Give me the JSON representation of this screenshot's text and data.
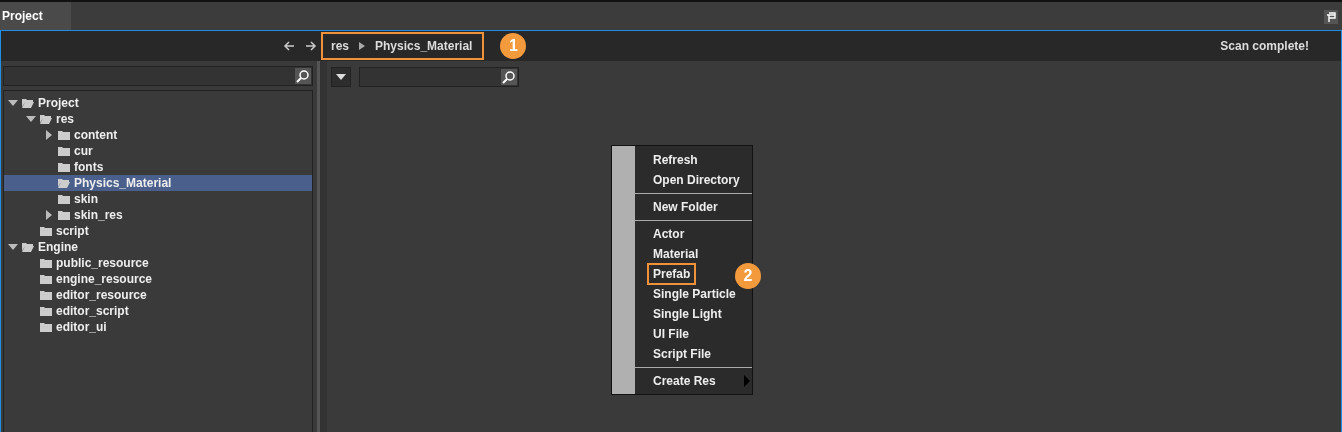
{
  "tab": {
    "label": "Project",
    "selected": true
  },
  "breadcrumb": {
    "items": [
      "res",
      "Physics_Material"
    ],
    "callout": "1"
  },
  "status": "Scan complete!",
  "tree": [
    {
      "label": "Project",
      "expanded": true,
      "selected": false,
      "children": [
        {
          "label": "res",
          "expanded": true,
          "selected": false,
          "children": [
            {
              "label": "content",
              "expanded": false,
              "selected": false
            },
            {
              "label": "cur",
              "selected": false
            },
            {
              "label": "fonts",
              "selected": false
            },
            {
              "label": "Physics_Material",
              "selected": true
            },
            {
              "label": "skin",
              "selected": false
            },
            {
              "label": "skin_res",
              "expanded": false,
              "selected": false
            }
          ]
        },
        {
          "label": "script",
          "selected": false
        }
      ]
    },
    {
      "label": "Engine",
      "expanded": true,
      "selected": false,
      "children": [
        {
          "label": "public_resource",
          "selected": false
        },
        {
          "label": "engine_resource",
          "selected": false
        },
        {
          "label": "editor_resource",
          "selected": false
        },
        {
          "label": "editor_script",
          "selected": false
        },
        {
          "label": "editor_ui",
          "selected": false
        }
      ]
    }
  ],
  "menu": [
    {
      "kind": "item",
      "label": "Refresh"
    },
    {
      "kind": "item",
      "label": "Open Directory"
    },
    {
      "kind": "separator"
    },
    {
      "kind": "item",
      "label": "New Folder"
    },
    {
      "kind": "separator"
    },
    {
      "kind": "item",
      "label": "Actor"
    },
    {
      "kind": "item",
      "label": "Material"
    },
    {
      "kind": "item",
      "label": "Prefab",
      "callout": "2"
    },
    {
      "kind": "item",
      "label": "Single Particle"
    },
    {
      "kind": "item",
      "label": "Single Light"
    },
    {
      "kind": "item",
      "label": "UI File"
    },
    {
      "kind": "item",
      "label": "Script File"
    },
    {
      "kind": "separator"
    },
    {
      "kind": "submenu",
      "label": "Create Res"
    }
  ]
}
